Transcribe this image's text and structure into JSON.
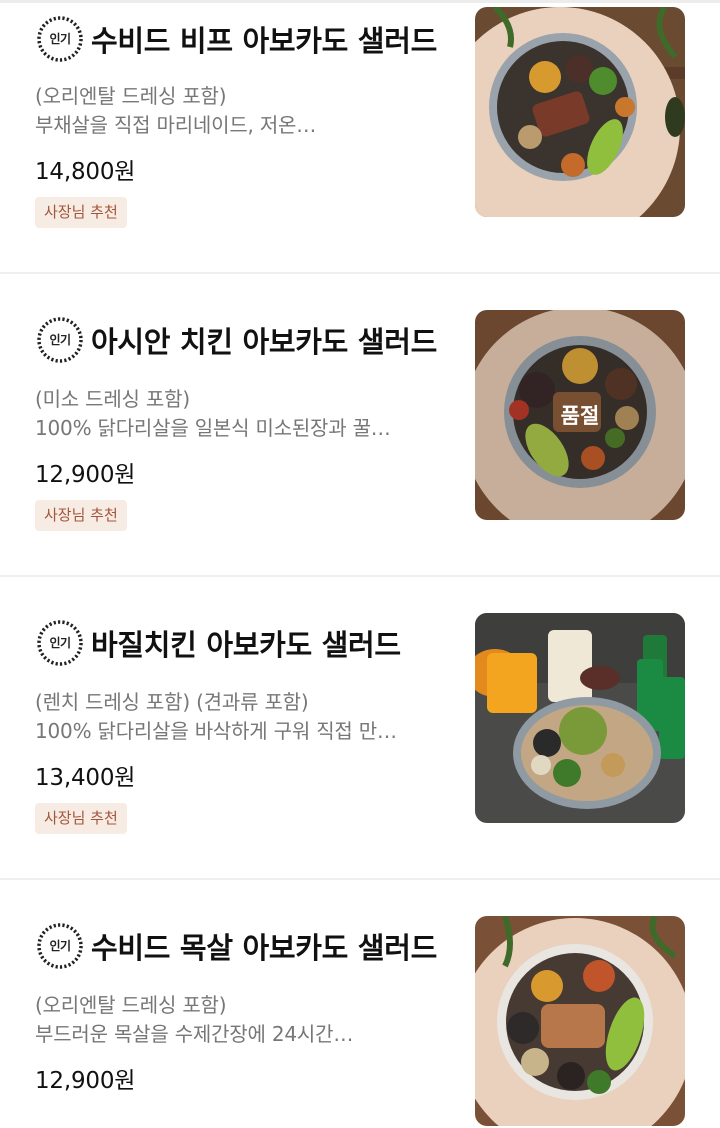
{
  "popular_badge": "인기",
  "items": [
    {
      "name": "수비드 비프 아보카도 샐러드",
      "subtitle": "(오리엔탈 드레싱 포함)",
      "description": "부채살을 직접 마리네이드, 저온…",
      "price": "14,800원",
      "tag": "사장님 추천",
      "sold_out": ""
    },
    {
      "name": "아시안 치킨 아보카도 샐러드",
      "subtitle": "(미소 드레싱 포함)",
      "description": "100% 닭다리살을 일본식 미소된장과 꿀…",
      "price": "12,900원",
      "tag": "사장님 추천",
      "sold_out": "품절"
    },
    {
      "name": "바질치킨 아보카도 샐러드",
      "subtitle": "(렌치 드레싱 포함) (견과류 포함)",
      "description": "100% 닭다리살을 바삭하게 구워 직접 만…",
      "price": "13,400원",
      "tag": "사장님 추천",
      "sold_out": ""
    },
    {
      "name": "수비드 목살 아보카도 샐러드",
      "subtitle": "(오리엔탈 드레싱 포함)",
      "description": "부드러운 목살을 수제간장에 24시간…",
      "price": "12,900원",
      "tag": "",
      "sold_out": ""
    }
  ],
  "colors": {
    "tag_text": "#a4553a",
    "tag_bg": "#f6ece4",
    "secondary_text": "#777777"
  }
}
